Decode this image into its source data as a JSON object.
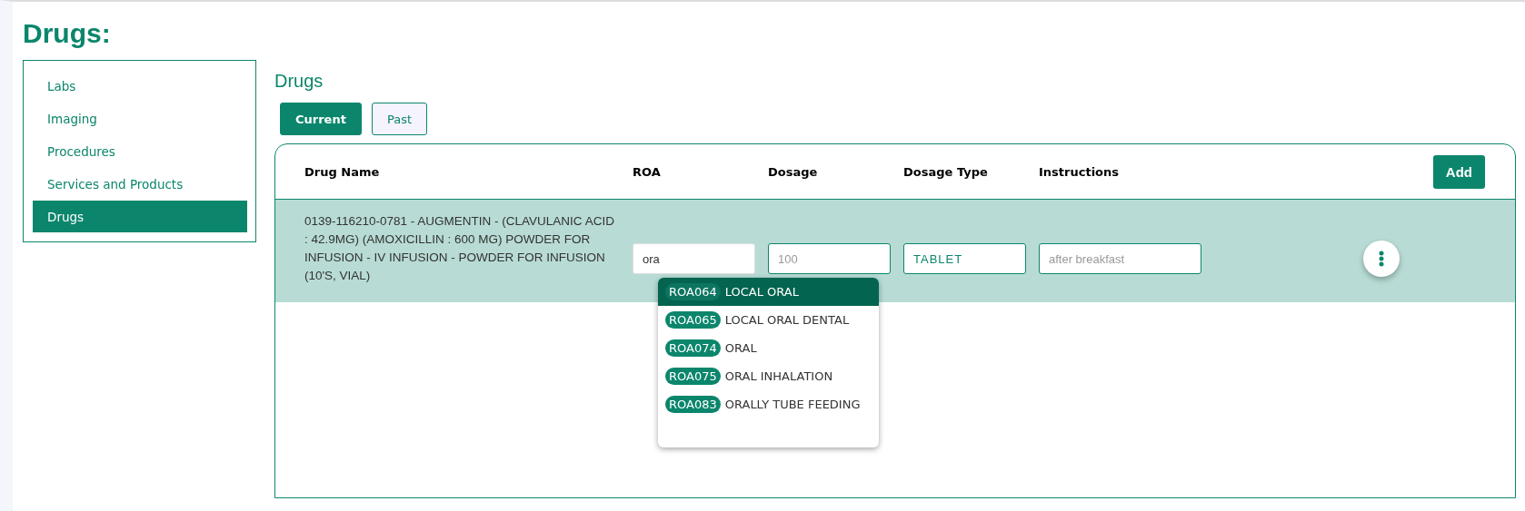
{
  "page_title": "Drugs:",
  "sidebar": {
    "items": [
      {
        "label": "Labs",
        "selected": false
      },
      {
        "label": "Imaging",
        "selected": false
      },
      {
        "label": "Procedures",
        "selected": false
      },
      {
        "label": "Services and Products",
        "selected": false
      },
      {
        "label": "Drugs",
        "selected": true
      }
    ]
  },
  "section_title": "Drugs",
  "tabs": [
    {
      "label": "Current",
      "selected": true
    },
    {
      "label": "Past",
      "selected": false
    }
  ],
  "table": {
    "columns": [
      "Drug Name",
      "ROA",
      "Dosage",
      "Dosage Type",
      "Instructions"
    ],
    "add_button": "Add",
    "rows": [
      {
        "drug_name": "0139-116210-0781 - AUGMENTIN - (CLAVULANIC ACID : 42.9MG) (AMOXICILLIN : 600 MG) POWDER FOR INFUSION - IV INFUSION - POWDER FOR INFUSION (10'S, VIAL)",
        "roa": {
          "value": "ora"
        },
        "dosage": {
          "placeholder": "100"
        },
        "dosage_type": {
          "value": "TABLET"
        },
        "instructions": {
          "placeholder": "after breakfast"
        }
      }
    ]
  },
  "roa_dropdown": {
    "options": [
      {
        "code": "ROA064",
        "label": "LOCAL ORAL",
        "selected": true
      },
      {
        "code": "ROA065",
        "label": "LOCAL ORAL DENTAL",
        "selected": false
      },
      {
        "code": "ROA074",
        "label": "ORAL",
        "selected": false
      },
      {
        "code": "ROA075",
        "label": "ORAL INHALATION",
        "selected": false
      },
      {
        "code": "ROA083",
        "label": "ORALLY TUBE FEEDING",
        "selected": false
      }
    ]
  }
}
